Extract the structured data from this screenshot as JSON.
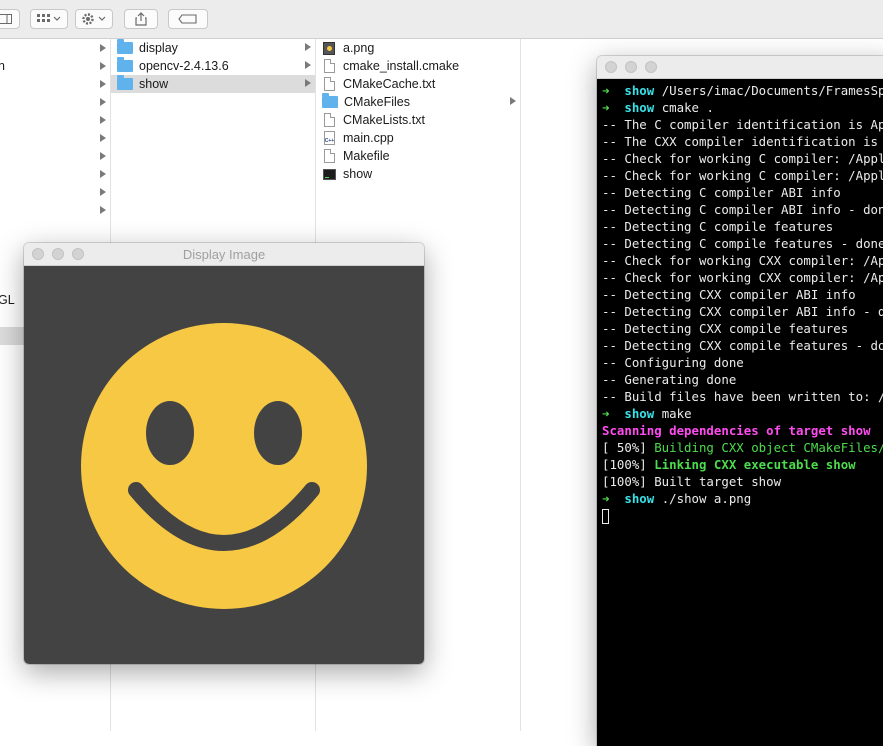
{
  "finder": {
    "col1": {
      "partial_items": [
        "n",
        "GL"
      ]
    },
    "col2": {
      "items": [
        {
          "label": "display",
          "kind": "folder"
        },
        {
          "label": "opencv-2.4.13.6",
          "kind": "folder"
        },
        {
          "label": "show",
          "kind": "folder",
          "selected": true
        }
      ]
    },
    "col3": {
      "items": [
        {
          "label": "a.png",
          "kind": "image"
        },
        {
          "label": "cmake_install.cmake",
          "kind": "file"
        },
        {
          "label": "CMakeCache.txt",
          "kind": "file"
        },
        {
          "label": "CMakeFiles",
          "kind": "folder"
        },
        {
          "label": "CMakeLists.txt",
          "kind": "file"
        },
        {
          "label": "main.cpp",
          "kind": "cpp"
        },
        {
          "label": "Makefile",
          "kind": "file"
        },
        {
          "label": "show",
          "kind": "exec"
        }
      ]
    }
  },
  "display_window": {
    "title": "Display Image",
    "bg_color": "#434343",
    "smiley_color": "#f6c844"
  },
  "terminal": {
    "lines": [
      {
        "type": "prompt",
        "dir": "show",
        "cmd": " /Users/imac/Documents/FramesSpace"
      },
      {
        "type": "prompt",
        "dir": "show",
        "cmd": " cmake ."
      },
      {
        "type": "plain",
        "text": "-- The C compiler identification is Apple"
      },
      {
        "type": "plain",
        "text": "-- The CXX compiler identification is Appl"
      },
      {
        "type": "plain",
        "text": "-- Check for working C compiler: /Applica"
      },
      {
        "type": "plain",
        "text": "-- Check for working C compiler: /Applica"
      },
      {
        "type": "plain",
        "text": "-- Detecting C compiler ABI info"
      },
      {
        "type": "plain",
        "text": "-- Detecting C compiler ABI info - done"
      },
      {
        "type": "plain",
        "text": "-- Detecting C compile features"
      },
      {
        "type": "plain",
        "text": "-- Detecting C compile features - done"
      },
      {
        "type": "plain",
        "text": "-- Check for working CXX compiler: /Appli"
      },
      {
        "type": "plain",
        "text": "-- Check for working CXX compiler: /Appli"
      },
      {
        "type": "plain",
        "text": "-- Detecting CXX compiler ABI info"
      },
      {
        "type": "plain",
        "text": "-- Detecting CXX compiler ABI info - done"
      },
      {
        "type": "plain",
        "text": "-- Detecting CXX compile features"
      },
      {
        "type": "plain",
        "text": "-- Detecting CXX compile features - done"
      },
      {
        "type": "plain",
        "text": "-- Configuring done"
      },
      {
        "type": "plain",
        "text": "-- Generating done"
      },
      {
        "type": "plain",
        "text": "-- Build files have been written to: /Use"
      },
      {
        "type": "prompt",
        "dir": "show",
        "cmd": " make"
      },
      {
        "type": "magenta",
        "text": "Scanning dependencies of target show"
      },
      {
        "type": "progress",
        "pct": "[ 50%] ",
        "text": "Building CXX object CMakeFiles/sho",
        "style": "grn"
      },
      {
        "type": "progress",
        "pct": "[100%] ",
        "text": "Linking CXX executable show",
        "style": "grnb"
      },
      {
        "type": "progress",
        "pct": "[100%] ",
        "text": "Built target show",
        "style": "plain"
      },
      {
        "type": "prompt",
        "dir": "show",
        "cmd": " ./show a.png"
      },
      {
        "type": "cursor"
      }
    ],
    "colors": {
      "bg": "#000000",
      "prompt_arrow": "#4ddc4d",
      "dir": "#38e2e8",
      "magenta": "#ff4cf0",
      "green": "#4ddc4d"
    }
  }
}
